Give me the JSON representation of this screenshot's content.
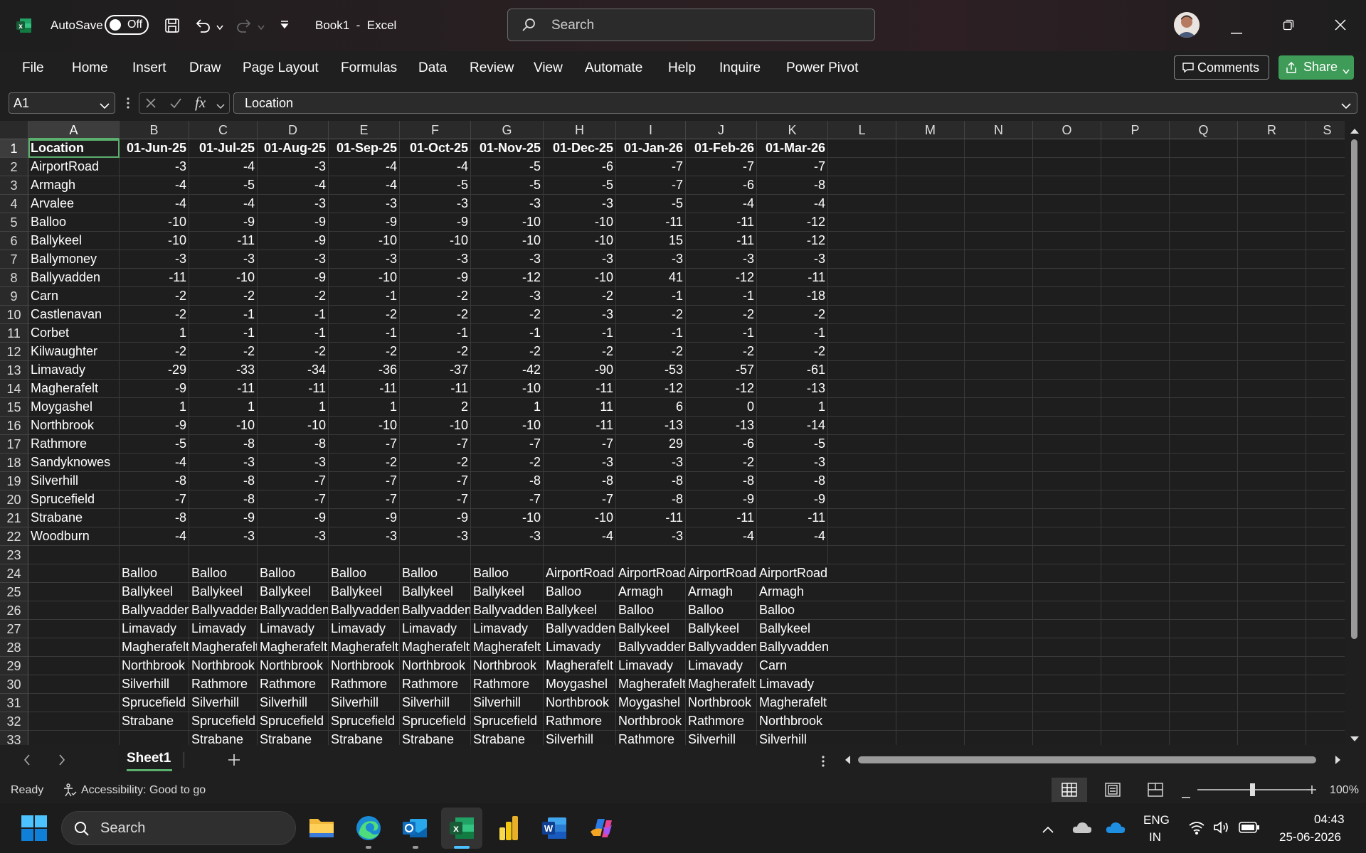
{
  "window": {
    "autosave_label": "AutoSave",
    "autosave_state": "Off",
    "title": "Book1  -  Excel",
    "search_placeholder": "Search"
  },
  "ribbon": {
    "tabs": [
      "File",
      "Home",
      "Insert",
      "Draw",
      "Page Layout",
      "Formulas",
      "Data",
      "Review",
      "View",
      "Automate",
      "Help",
      "Inquire",
      "Power Pivot"
    ],
    "comments_label": "Comments",
    "share_label": "Share"
  },
  "formula_bar": {
    "name_box": "A1",
    "fx_label": "fx",
    "content": "Location"
  },
  "grid": {
    "columns": [
      "A",
      "B",
      "C",
      "D",
      "E",
      "F",
      "G",
      "H",
      "I",
      "J",
      "K",
      "L",
      "M",
      "N",
      "O",
      "P",
      "Q",
      "R",
      "S"
    ],
    "header_row": [
      "Location",
      "01-Jun-25",
      "01-Jul-25",
      "01-Aug-25",
      "01-Sep-25",
      "01-Oct-25",
      "01-Nov-25",
      "01-Dec-25",
      "01-Jan-26",
      "01-Feb-26",
      "01-Mar-26"
    ],
    "data_rows": [
      [
        "AirportRoad",
        "-3",
        "-4",
        "-3",
        "-4",
        "-4",
        "-5",
        "-6",
        "-7",
        "-7",
        "-7"
      ],
      [
        "Armagh",
        "-4",
        "-5",
        "-4",
        "-4",
        "-5",
        "-5",
        "-5",
        "-7",
        "-6",
        "-8"
      ],
      [
        "Arvalee",
        "-4",
        "-4",
        "-3",
        "-3",
        "-3",
        "-3",
        "-3",
        "-5",
        "-4",
        "-4"
      ],
      [
        "Balloo",
        "-10",
        "-9",
        "-9",
        "-9",
        "-9",
        "-10",
        "-10",
        "-11",
        "-11",
        "-12"
      ],
      [
        "Ballykeel",
        "-10",
        "-11",
        "-9",
        "-10",
        "-10",
        "-10",
        "-10",
        "15",
        "-11",
        "-12"
      ],
      [
        "Ballymoney",
        "-3",
        "-3",
        "-3",
        "-3",
        "-3",
        "-3",
        "-3",
        "-3",
        "-3",
        "-3"
      ],
      [
        "Ballyvadden",
        "-11",
        "-10",
        "-9",
        "-10",
        "-9",
        "-12",
        "-10",
        "41",
        "-12",
        "-11"
      ],
      [
        "Carn",
        "-2",
        "-2",
        "-2",
        "-1",
        "-2",
        "-3",
        "-2",
        "-1",
        "-1",
        "-18"
      ],
      [
        "Castlenavan",
        "-2",
        "-1",
        "-1",
        "-2",
        "-2",
        "-2",
        "-3",
        "-2",
        "-2",
        "-2"
      ],
      [
        "Corbet",
        "1",
        "-1",
        "-1",
        "-1",
        "-1",
        "-1",
        "-1",
        "-1",
        "-1",
        "-1"
      ],
      [
        "Kilwaughter",
        "-2",
        "-2",
        "-2",
        "-2",
        "-2",
        "-2",
        "-2",
        "-2",
        "-2",
        "-2"
      ],
      [
        "Limavady",
        "-29",
        "-33",
        "-34",
        "-36",
        "-37",
        "-42",
        "-90",
        "-53",
        "-57",
        "-61"
      ],
      [
        "Magherafelt",
        "-9",
        "-11",
        "-11",
        "-11",
        "-11",
        "-10",
        "-11",
        "-12",
        "-12",
        "-13"
      ],
      [
        "Moygashel",
        "1",
        "1",
        "1",
        "1",
        "2",
        "1",
        "11",
        "6",
        "0",
        "1"
      ],
      [
        "Northbrook",
        "-9",
        "-10",
        "-10",
        "-10",
        "-10",
        "-10",
        "-11",
        "-13",
        "-13",
        "-14"
      ],
      [
        "Rathmore",
        "-5",
        "-8",
        "-8",
        "-7",
        "-7",
        "-7",
        "-7",
        "29",
        "-6",
        "-5"
      ],
      [
        "Sandyknowes",
        "-4",
        "-3",
        "-3",
        "-2",
        "-2",
        "-2",
        "-3",
        "-3",
        "-2",
        "-3"
      ],
      [
        "Silverhill",
        "-8",
        "-8",
        "-7",
        "-7",
        "-7",
        "-8",
        "-8",
        "-8",
        "-8",
        "-8"
      ],
      [
        "Sprucefield",
        "-7",
        "-8",
        "-7",
        "-7",
        "-7",
        "-7",
        "-7",
        "-8",
        "-9",
        "-9"
      ],
      [
        "Strabane",
        "-8",
        "-9",
        "-9",
        "-9",
        "-9",
        "-10",
        "-10",
        "-11",
        "-11",
        "-11"
      ],
      [
        "Woodburn",
        "-4",
        "-3",
        "-3",
        "-3",
        "-3",
        "-3",
        "-4",
        "-3",
        "-4",
        "-4"
      ]
    ],
    "list_rows": [
      [
        "Balloo",
        "Balloo",
        "Balloo",
        "Balloo",
        "Balloo",
        "Balloo",
        "AirportRoad",
        "AirportRoad",
        "AirportRoad",
        "AirportRoad"
      ],
      [
        "Ballykeel",
        "Ballykeel",
        "Ballykeel",
        "Ballykeel",
        "Ballykeel",
        "Ballykeel",
        "Balloo",
        "Armagh",
        "Armagh",
        "Armagh"
      ],
      [
        "Ballyvadden",
        "Ballyvadden",
        "Ballyvadden",
        "Ballyvadden",
        "Ballyvadden",
        "Ballyvadden",
        "Ballykeel",
        "Balloo",
        "Balloo",
        "Balloo"
      ],
      [
        "Limavady",
        "Limavady",
        "Limavady",
        "Limavady",
        "Limavady",
        "Limavady",
        "Ballyvadden",
        "Ballykeel",
        "Ballykeel",
        "Ballykeel"
      ],
      [
        "Magherafelt",
        "Magherafelt",
        "Magherafelt",
        "Magherafelt",
        "Magherafelt",
        "Magherafelt",
        "Limavady",
        "Ballyvadden",
        "Ballyvadden",
        "Ballyvadden"
      ],
      [
        "Northbrook",
        "Northbrook",
        "Northbrook",
        "Northbrook",
        "Northbrook",
        "Northbrook",
        "Magherafelt",
        "Limavady",
        "Limavady",
        "Carn"
      ],
      [
        "Silverhill",
        "Rathmore",
        "Rathmore",
        "Rathmore",
        "Rathmore",
        "Rathmore",
        "Moygashel",
        "Magherafelt",
        "Magherafelt",
        "Limavady"
      ],
      [
        "Sprucefield",
        "Silverhill",
        "Silverhill",
        "Silverhill",
        "Silverhill",
        "Silverhill",
        "Northbrook",
        "Moygashel",
        "Northbrook",
        "Magherafelt"
      ],
      [
        "Strabane",
        "Sprucefield",
        "Sprucefield",
        "Sprucefield",
        "Sprucefield",
        "Sprucefield",
        "Rathmore",
        "Northbrook",
        "Rathmore",
        "Northbrook"
      ],
      [
        "",
        "Strabane",
        "Strabane",
        "Strabane",
        "Strabane",
        "Strabane",
        "Silverhill",
        "Rathmore",
        "Silverhill",
        "Silverhill"
      ]
    ]
  },
  "sheets": {
    "active": "Sheet1"
  },
  "status": {
    "ready": "Ready",
    "accessibility": "Accessibility: Good to go",
    "zoom": "100%"
  },
  "taskbar": {
    "search_placeholder": "Search",
    "language_line1": "ENG",
    "language_line2": "IN",
    "time": "04:43",
    "date": "25-06-2026"
  }
}
